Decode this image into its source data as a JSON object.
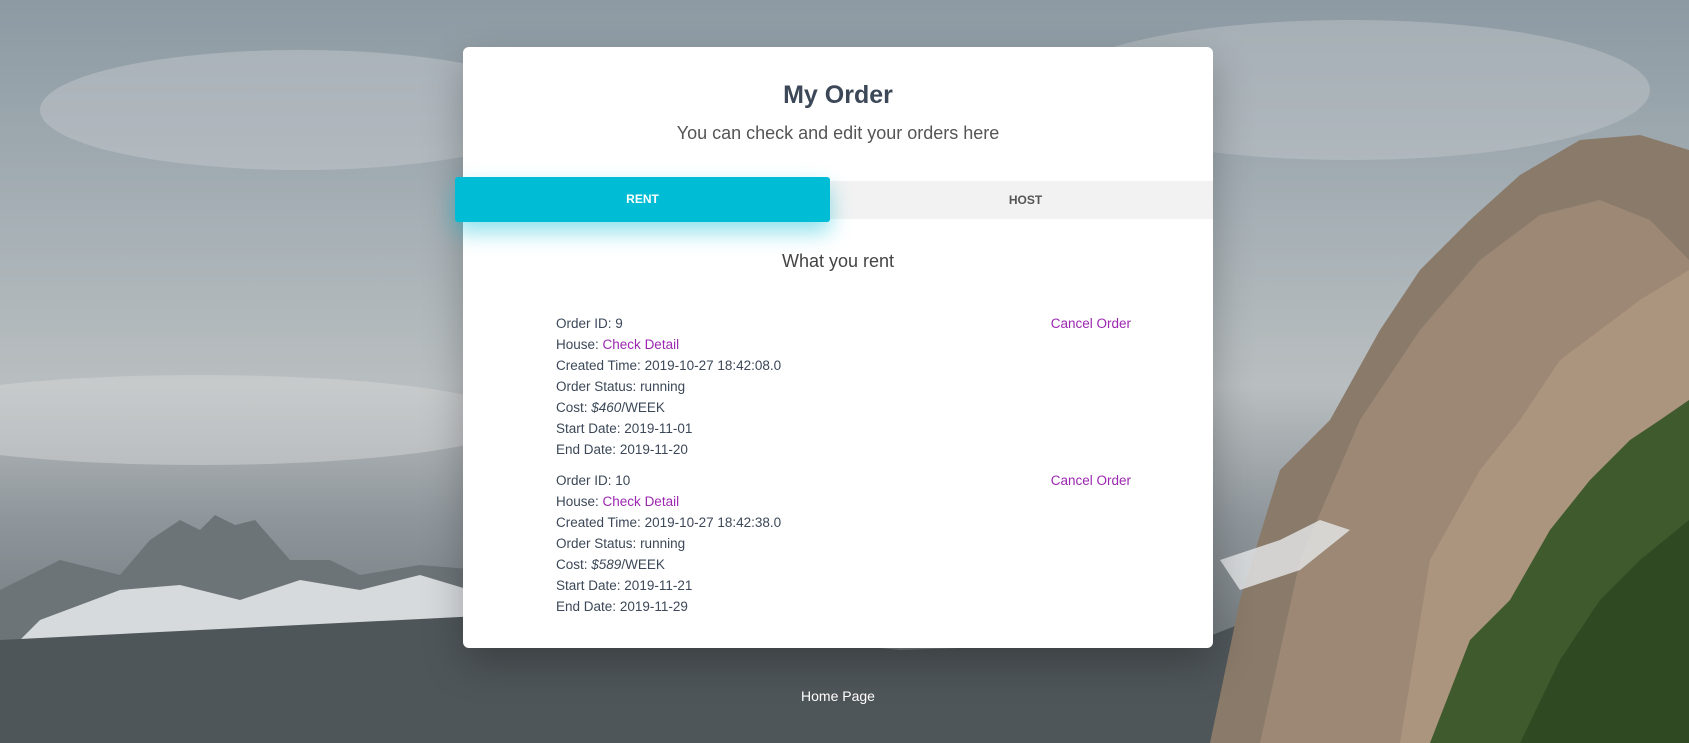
{
  "page": {
    "title": "My Order",
    "subtitle": "You can check and edit your orders here"
  },
  "tabs": [
    {
      "label": "RENT",
      "active": true
    },
    {
      "label": "HOST",
      "active": false
    }
  ],
  "section_title": "What you rent",
  "labels": {
    "order_id": "Order ID:",
    "house": "House:",
    "created_time": "Created Time:",
    "order_status": "Order Status:",
    "cost": "Cost:",
    "start_date": "Start Date:",
    "end_date": "End Date:",
    "check_detail": "Check Detail",
    "cancel_order": "Cancel Order"
  },
  "orders": [
    {
      "id": "9",
      "created_time": "2019-10-27 18:42:08.0",
      "status": "running",
      "cost": "$460",
      "cost_unit": "/WEEK",
      "start_date": "2019-11-01",
      "end_date": "2019-11-20"
    },
    {
      "id": "10",
      "created_time": "2019-10-27 18:42:38.0",
      "status": "running",
      "cost": "$589",
      "cost_unit": "/WEEK",
      "start_date": "2019-11-21",
      "end_date": "2019-11-29"
    }
  ],
  "footer": {
    "home_link": "Home Page"
  },
  "colors": {
    "accent": "#00bcd4",
    "link": "#9c27b0",
    "title": "#3c4858"
  }
}
